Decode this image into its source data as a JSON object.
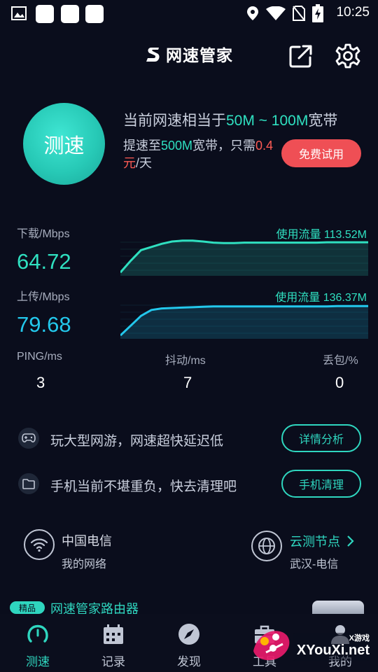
{
  "status_bar": {
    "time": "10:25",
    "icons": [
      "image-notification-icon",
      "app-notification-icon",
      "location-icon",
      "wifi-icon",
      "no-sim-icon",
      "battery-charging-icon"
    ]
  },
  "header": {
    "title": "网速管家",
    "share_icon": "share-icon",
    "settings_icon": "gear-icon"
  },
  "speed_test": {
    "button_label": "测速",
    "promo_prefix": "当前网速相当于",
    "promo_range": "50M ~ 100M",
    "promo_suffix": "宽带",
    "upgrade_prefix": "提速至",
    "upgrade_speed": "500M",
    "upgrade_mid": "宽带，只需",
    "upgrade_price": "0.4元",
    "upgrade_unit": "/天",
    "trial_button": "免费试用"
  },
  "download": {
    "label": "下载/Mbps",
    "value": "64.72",
    "usage": "使用流量 113.52M",
    "color": "#2fe0c0",
    "trace": [
      0.05,
      0.35,
      0.62,
      0.7,
      0.78,
      0.84,
      0.86,
      0.86,
      0.84,
      0.81,
      0.8,
      0.8,
      0.81,
      0.81,
      0.81,
      0.81,
      0.81,
      0.81,
      0.81,
      0.81,
      0.82,
      0.82,
      0.82,
      0.82,
      0.82
    ]
  },
  "upload": {
    "label": "上传/Mbps",
    "value": "79.68",
    "usage": "使用流量 136.37M",
    "color": "#23c8ec",
    "trace": [
      0.05,
      0.3,
      0.55,
      0.7,
      0.74,
      0.75,
      0.76,
      0.77,
      0.78,
      0.79,
      0.79,
      0.79,
      0.79,
      0.79,
      0.79,
      0.79,
      0.79,
      0.79,
      0.79,
      0.79,
      0.79,
      0.8,
      0.8,
      0.8,
      0.8
    ]
  },
  "stats": {
    "ping_label": "PING/ms",
    "ping_value": "3",
    "jitter_label": "抖动/ms",
    "jitter_value": "7",
    "loss_label": "丢包/%",
    "loss_value": "0"
  },
  "tips": {
    "game_text": "玩大型网游，网速超快延迟低",
    "game_button": "详情分析",
    "clean_text": "手机当前不堪重负，快去清理吧",
    "clean_button": "手机清理"
  },
  "network": {
    "carrier": "中国电信",
    "carrier_sub": "我的网络",
    "node_label": "云测节点",
    "node_value": "武汉-电信"
  },
  "router_promo": {
    "badge": "精品",
    "text": "网速管家路由器"
  },
  "nav": {
    "items": [
      {
        "label": "测速",
        "icon": "speedometer-icon",
        "active": true
      },
      {
        "label": "记录",
        "icon": "calendar-icon",
        "active": false
      },
      {
        "label": "发现",
        "icon": "compass-icon",
        "active": false
      },
      {
        "label": "工具",
        "icon": "toolbox-icon",
        "active": false
      },
      {
        "label": "我的",
        "icon": "user-icon",
        "active": false
      }
    ]
  },
  "watermark": {
    "site": "XYouXi.net",
    "tag": "X游戏"
  }
}
